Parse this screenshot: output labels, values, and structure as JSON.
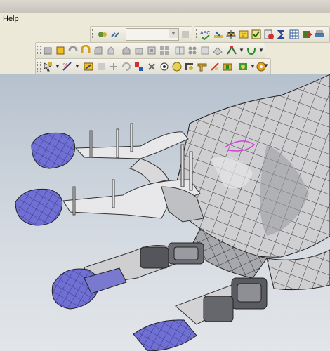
{
  "menu": {
    "help_label": "Help"
  },
  "toolbars": {
    "standard_icons": [
      "spell-check-icon",
      "measure-icon",
      "balance-icon",
      "note-icon",
      "checkbox-icon",
      "settings-check-icon",
      "sigma-icon",
      "grid-icon",
      "export-icon"
    ],
    "features_icons": [
      "extrude-icon",
      "cut-icon",
      "revolve-icon",
      "sweep-icon",
      "fillet-icon",
      "chamfer-icon",
      "shell-icon",
      "draft-icon",
      "rib-icon",
      "pattern-icon",
      "mirror-icon",
      "hole-icon",
      "curve-icon",
      "spline-icon"
    ],
    "assembly_icons": [
      "select-icon",
      "sketch-icon",
      "mate-icon",
      "move-icon",
      "rotate-icon",
      "explode-icon",
      "hide-icon",
      "show-icon",
      "color-icon",
      "section-icon",
      "render-icon",
      "light-icon",
      "camera-icon"
    ]
  },
  "viewport": {
    "description_hidden": true,
    "colors": {
      "fingertip": "#6f6fd4",
      "mesh": "#3a3a3a",
      "bone": "#e8e8ea",
      "sketch": "#d63fd6",
      "background_top": "#b6c1ce",
      "background_bottom": "#e2e5e9"
    }
  }
}
